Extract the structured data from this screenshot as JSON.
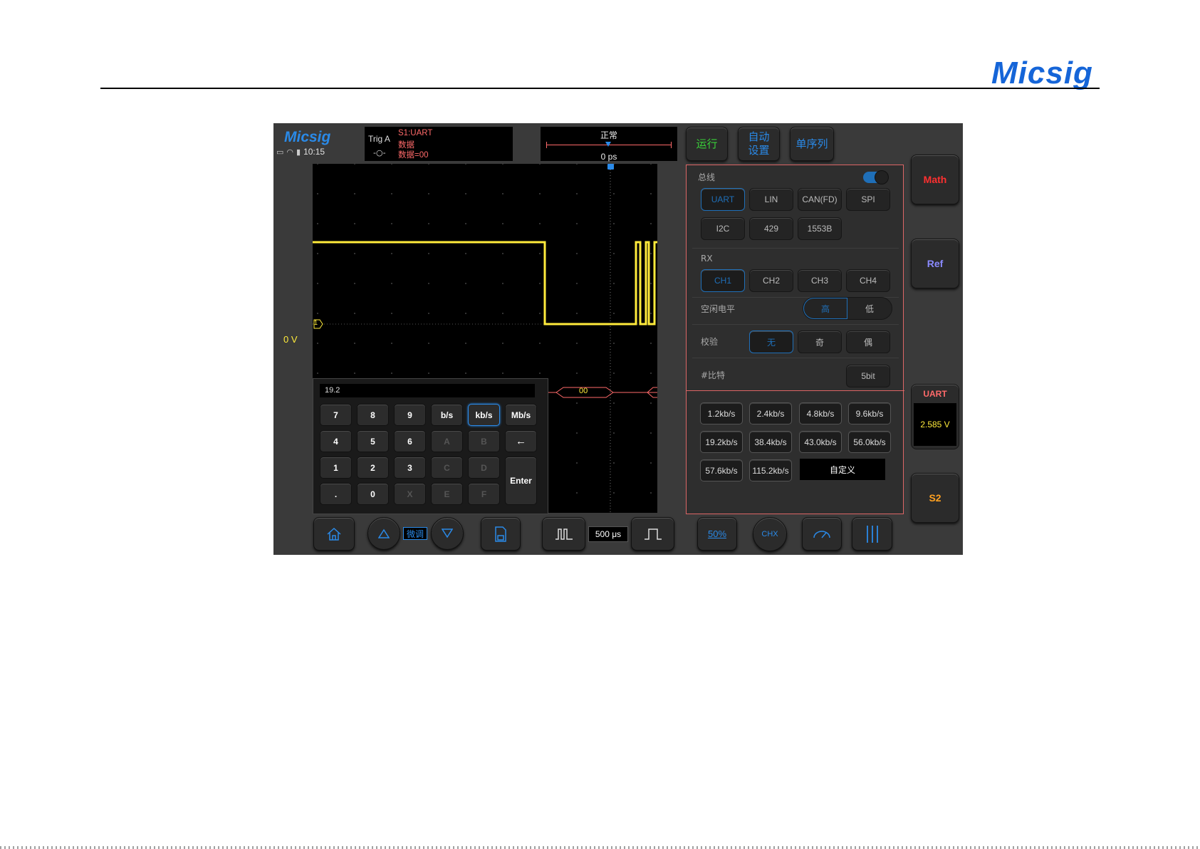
{
  "doc": {
    "logo": "Micsig"
  },
  "scope": {
    "logo": "Micsig",
    "time": "10:15",
    "trigger": {
      "label": "Trig  A",
      "source": "S1:UART",
      "type": "数据",
      "condition": "数据=00"
    },
    "timebase": {
      "mode": "正常",
      "offset": "0 ps"
    },
    "top_buttons": {
      "run": "运行",
      "auto_line1": "自动",
      "auto_line2": "设置",
      "single": "单序列"
    },
    "right_buttons": {
      "math": "Math",
      "ref": "Ref",
      "s2": "S2"
    },
    "uart_readout": {
      "title": "UART",
      "value": "2.585  V"
    },
    "zero_level": "0  V",
    "channel_marker": "1",
    "decode_value": "00",
    "keypad": {
      "display": "19.2",
      "keys": [
        "7",
        "8",
        "9",
        "b/s",
        "kb/s",
        "Mb/s",
        "4",
        "5",
        "6",
        "A",
        "B",
        "←",
        "1",
        "2",
        "3",
        "C",
        "D",
        ".",
        "0",
        "X",
        "E",
        "F",
        "Enter"
      ]
    },
    "panel": {
      "bus_label": "总线",
      "bus_types": [
        "UART",
        "LIN",
        "CAN(FD)",
        "SPI",
        "I2C",
        "429",
        "1553B"
      ],
      "rx_label": "RX",
      "rx_channels": [
        "CH1",
        "CH2",
        "CH3",
        "CH4"
      ],
      "idle_label": "空闲电平",
      "idle_options": [
        "高",
        "低"
      ],
      "parity_label": "校验",
      "parity_options": [
        "无",
        "奇",
        "偶"
      ],
      "bits_label": "#比特",
      "bits_value": "5bit",
      "baud_rates": [
        "1.2kb/s",
        "2.4kb/s",
        "4.8kb/s",
        "9.6kb/s",
        "19.2kb/s",
        "38.4kb/s",
        "43.0kb/s",
        "56.0kb/s",
        "57.6kb/s",
        "115.2kb/s"
      ],
      "custom": "自定义"
    },
    "bottom": {
      "fine": "微调",
      "timebase": "500 μs",
      "percent": "50%",
      "chx": "CHX"
    }
  },
  "colors": {
    "accent": "#2a8ae8",
    "trace": "#ffeb3b",
    "bus": "#ff6a6a",
    "math": "#ff3030",
    "ref": "#8a8aff",
    "s2": "#ffa020",
    "run": "#39d239"
  }
}
